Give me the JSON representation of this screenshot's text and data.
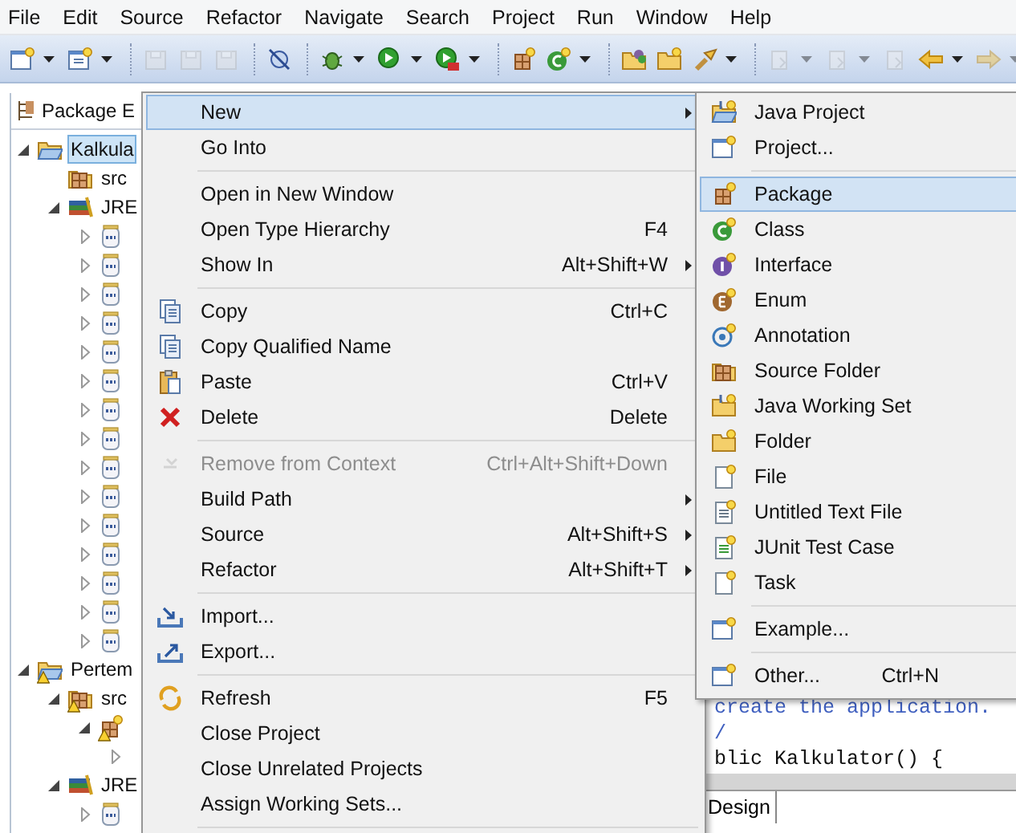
{
  "menubar": [
    {
      "label": "File"
    },
    {
      "label": "Edit"
    },
    {
      "label": "Source"
    },
    {
      "label": "Refactor"
    },
    {
      "label": "Navigate"
    },
    {
      "label": "Search"
    },
    {
      "label": "Project"
    },
    {
      "label": "Run"
    },
    {
      "label": "Window"
    },
    {
      "label": "Help"
    }
  ],
  "toolbar": [
    {
      "kind": "new",
      "disabled": false,
      "dropdown": true
    },
    {
      "kind": "new-wizard",
      "disabled": false,
      "dropdown": true
    },
    {
      "kind": "separator"
    },
    {
      "kind": "save",
      "disabled": true,
      "dropdown": false
    },
    {
      "kind": "save-all",
      "disabled": true,
      "dropdown": false
    },
    {
      "kind": "print",
      "disabled": true,
      "dropdown": false
    },
    {
      "kind": "separator"
    },
    {
      "kind": "skip-breakpoints",
      "disabled": false,
      "dropdown": false
    },
    {
      "kind": "separator"
    },
    {
      "kind": "debug",
      "disabled": false,
      "dropdown": true
    },
    {
      "kind": "run",
      "disabled": false,
      "dropdown": true
    },
    {
      "kind": "external-tools",
      "disabled": false,
      "dropdown": true
    },
    {
      "kind": "separator"
    },
    {
      "kind": "new-package",
      "disabled": false,
      "dropdown": false
    },
    {
      "kind": "new-class",
      "disabled": false,
      "dropdown": true
    },
    {
      "kind": "separator"
    },
    {
      "kind": "open-type",
      "disabled": false,
      "dropdown": false
    },
    {
      "kind": "open-task",
      "disabled": false,
      "dropdown": false
    },
    {
      "kind": "search",
      "disabled": false,
      "dropdown": true
    },
    {
      "kind": "separator"
    },
    {
      "kind": "next-annotation",
      "disabled": true,
      "dropdown": true
    },
    {
      "kind": "prev-annotation",
      "disabled": true,
      "dropdown": true
    },
    {
      "kind": "last-edit",
      "disabled": true,
      "dropdown": false
    },
    {
      "kind": "back",
      "disabled": false,
      "dropdown": true
    },
    {
      "kind": "forward",
      "disabled": true,
      "dropdown": true
    }
  ],
  "package_explorer": {
    "title": "Package E",
    "tree": [
      {
        "kind": "project",
        "label": "Kalkula",
        "selected": true,
        "warning": false,
        "expanded": true,
        "children": [
          {
            "kind": "source-folder",
            "label": "src",
            "selected": false,
            "warning": false
          },
          {
            "kind": "library",
            "label": "JRE",
            "selected": false,
            "warning": false,
            "expanded": true,
            "children": [
              {
                "kind": "jar",
                "selected": false,
                "warning": false,
                "expanded": false
              },
              {
                "kind": "jar",
                "selected": false,
                "warning": false,
                "expanded": false
              },
              {
                "kind": "jar",
                "selected": false,
                "warning": false,
                "expanded": false
              },
              {
                "kind": "jar",
                "selected": false,
                "warning": false,
                "expanded": false
              },
              {
                "kind": "jar",
                "selected": false,
                "warning": false,
                "expanded": false
              },
              {
                "kind": "jar",
                "selected": false,
                "warning": false,
                "expanded": false
              },
              {
                "kind": "jar",
                "selected": false,
                "warning": false,
                "expanded": false
              },
              {
                "kind": "jar",
                "selected": false,
                "warning": false,
                "expanded": false
              },
              {
                "kind": "jar",
                "selected": false,
                "warning": false,
                "expanded": false
              },
              {
                "kind": "jar",
                "selected": false,
                "warning": false,
                "expanded": false
              },
              {
                "kind": "jar",
                "selected": false,
                "warning": false,
                "expanded": false
              },
              {
                "kind": "jar",
                "selected": false,
                "warning": false,
                "expanded": false
              },
              {
                "kind": "jar",
                "selected": false,
                "warning": false,
                "expanded": false
              },
              {
                "kind": "jar",
                "selected": false,
                "warning": false,
                "expanded": false
              },
              {
                "kind": "jar",
                "selected": false,
                "warning": false,
                "expanded": false
              }
            ]
          }
        ]
      },
      {
        "kind": "project",
        "label": "Pertem",
        "selected": false,
        "warning": true,
        "expanded": true,
        "children": [
          {
            "kind": "source-folder",
            "label": "src",
            "selected": false,
            "warning": true,
            "expanded": true,
            "children": [
              {
                "kind": "package",
                "selected": false,
                "warning": true,
                "expanded": true,
                "children": [
                  {
                    "selected": false,
                    "expanded": false
                  }
                ]
              }
            ]
          },
          {
            "kind": "library",
            "label": "JRE",
            "selected": false,
            "warning": false,
            "expanded": true,
            "children": [
              {
                "kind": "jar",
                "selected": false,
                "warning": false,
                "expanded": false
              }
            ]
          }
        ]
      }
    ]
  },
  "editor": {
    "code_lines": [
      {
        "kind": "comment",
        "text": "create the application."
      },
      {
        "kind": "comment",
        "text": "/"
      },
      {
        "kind": "code",
        "text": "blic Kalkulator() {"
      }
    ],
    "tabs": [
      {
        "label": "Design",
        "selected": true
      }
    ]
  },
  "context_menu": {
    "items": [
      {
        "kind": "item",
        "label": "New",
        "selected": true,
        "disabled": false,
        "submenu": true
      },
      {
        "kind": "item",
        "label": "Go Into",
        "selected": false,
        "disabled": false,
        "submenu": false
      },
      {
        "kind": "separator"
      },
      {
        "kind": "item",
        "label": "Open in New Window",
        "selected": false,
        "disabled": false,
        "submenu": false
      },
      {
        "kind": "item",
        "label": "Open Type Hierarchy",
        "shortcut": "F4",
        "selected": false,
        "disabled": false,
        "submenu": false
      },
      {
        "kind": "item",
        "label": "Show In",
        "shortcut": "Alt+Shift+W",
        "selected": false,
        "disabled": false,
        "submenu": true
      },
      {
        "kind": "separator"
      },
      {
        "kind": "item",
        "label": "Copy",
        "shortcut": "Ctrl+C",
        "selected": false,
        "disabled": false,
        "submenu": false
      },
      {
        "kind": "item",
        "label": "Copy Qualified Name",
        "selected": false,
        "disabled": false,
        "submenu": false
      },
      {
        "kind": "item",
        "label": "Paste",
        "shortcut": "Ctrl+V",
        "selected": false,
        "disabled": false,
        "submenu": false
      },
      {
        "kind": "item",
        "label": "Delete",
        "shortcut": "Delete",
        "selected": false,
        "disabled": false,
        "submenu": false
      },
      {
        "kind": "separator"
      },
      {
        "kind": "item",
        "label": "Remove from Context",
        "shortcut": "Ctrl+Alt+Shift+Down",
        "selected": false,
        "disabled": true,
        "submenu": false
      },
      {
        "kind": "item",
        "label": "Build Path",
        "selected": false,
        "disabled": false,
        "submenu": true
      },
      {
        "kind": "item",
        "label": "Source",
        "shortcut": "Alt+Shift+S",
        "selected": false,
        "disabled": false,
        "submenu": true
      },
      {
        "kind": "item",
        "label": "Refactor",
        "shortcut": "Alt+Shift+T",
        "selected": false,
        "disabled": false,
        "submenu": true
      },
      {
        "kind": "separator"
      },
      {
        "kind": "item",
        "label": "Import...",
        "selected": false,
        "disabled": false,
        "submenu": false
      },
      {
        "kind": "item",
        "label": "Export...",
        "selected": false,
        "disabled": false,
        "submenu": false
      },
      {
        "kind": "separator"
      },
      {
        "kind": "item",
        "label": "Refresh",
        "shortcut": "F5",
        "selected": false,
        "disabled": false,
        "submenu": false
      },
      {
        "kind": "item",
        "label": "Close Project",
        "selected": false,
        "disabled": false,
        "submenu": false
      },
      {
        "kind": "item",
        "label": "Close Unrelated Projects",
        "selected": false,
        "disabled": false,
        "submenu": false
      },
      {
        "kind": "item",
        "label": "Assign Working Sets...",
        "selected": false,
        "disabled": false,
        "submenu": false
      },
      {
        "kind": "separator"
      }
    ]
  },
  "new_submenu": {
    "items": [
      {
        "kind": "item",
        "label": "Java Project",
        "selected": false
      },
      {
        "kind": "item",
        "label": "Project...",
        "selected": false
      },
      {
        "kind": "separator"
      },
      {
        "kind": "item",
        "label": "Package",
        "selected": true
      },
      {
        "kind": "item",
        "label": "Class",
        "selected": false
      },
      {
        "kind": "item",
        "label": "Interface",
        "selected": false
      },
      {
        "kind": "item",
        "label": "Enum",
        "selected": false
      },
      {
        "kind": "item",
        "label": "Annotation",
        "selected": false
      },
      {
        "kind": "item",
        "label": "Source Folder",
        "selected": false
      },
      {
        "kind": "item",
        "label": "Java Working Set",
        "selected": false
      },
      {
        "kind": "item",
        "label": "Folder",
        "selected": false
      },
      {
        "kind": "item",
        "label": "File",
        "selected": false
      },
      {
        "kind": "item",
        "label": "Untitled Text File",
        "selected": false
      },
      {
        "kind": "item",
        "label": "JUnit Test Case",
        "selected": false
      },
      {
        "kind": "item",
        "label": "Task",
        "selected": false
      },
      {
        "kind": "separator"
      },
      {
        "kind": "item",
        "label": "Example...",
        "selected": false
      },
      {
        "kind": "separator"
      },
      {
        "kind": "item",
        "label": "Other...",
        "shortcut": "Ctrl+N",
        "selected": false
      }
    ]
  }
}
